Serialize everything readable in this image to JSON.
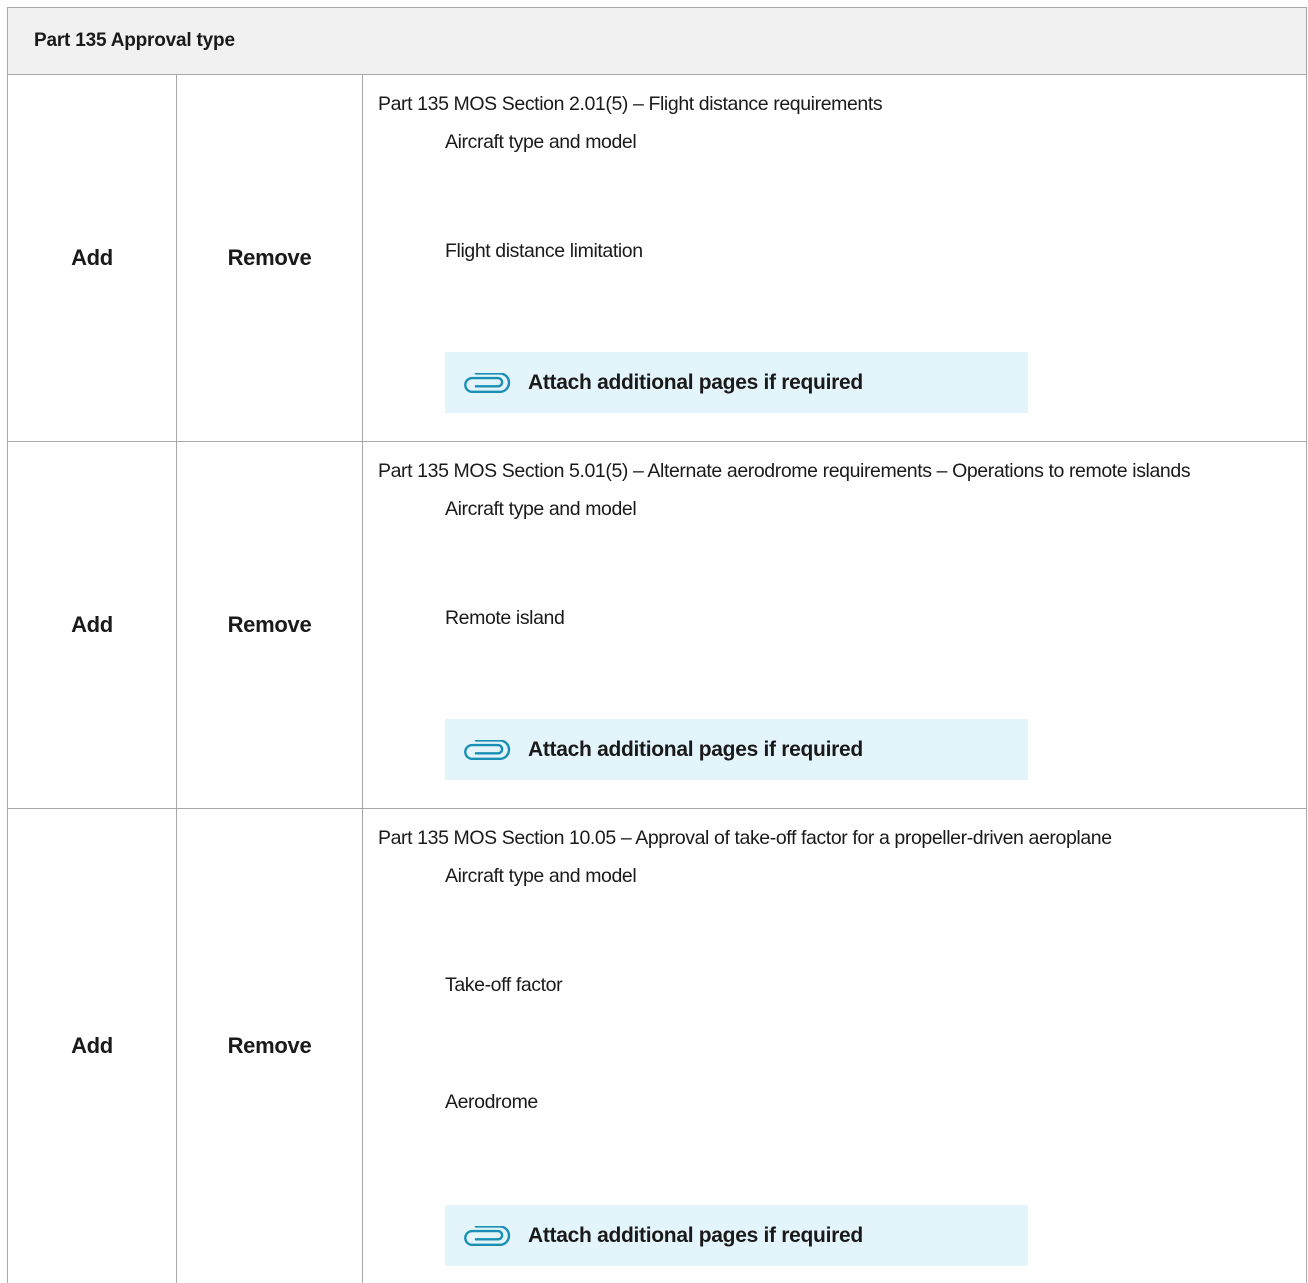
{
  "header": {
    "title": "Part 135 Approval type"
  },
  "rows": [
    {
      "add_label": "Add",
      "remove_label": "Remove",
      "section_title": "Part 135 MOS Section 2.01(5) – Flight distance requirements",
      "fields": [
        "Aircraft type and model",
        "Flight distance limitation"
      ],
      "attach_label": "Attach additional pages if required"
    },
    {
      "add_label": "Add",
      "remove_label": "Remove",
      "section_title": "Part 135 MOS Section 5.01(5) – Alternate aerodrome requirements – Operations to remote islands",
      "fields": [
        "Aircraft type and model",
        "Remote island"
      ],
      "attach_label": "Attach additional pages if required"
    },
    {
      "add_label": "Add",
      "remove_label": "Remove",
      "section_title": "Part 135 MOS Section 10.05 – Approval of take-off factor for a propeller-driven aeroplane",
      "fields": [
        "Aircraft type and model",
        "Take-off factor",
        "Aerodrome"
      ],
      "attach_label": "Attach additional pages if required"
    }
  ],
  "colors": {
    "accent": "#1a8fb5",
    "attach_background": "#e3f4fb",
    "header_background": "#f1f1f1",
    "border": "#a8a8a8"
  },
  "icons": {
    "attach": "paperclip-icon"
  }
}
